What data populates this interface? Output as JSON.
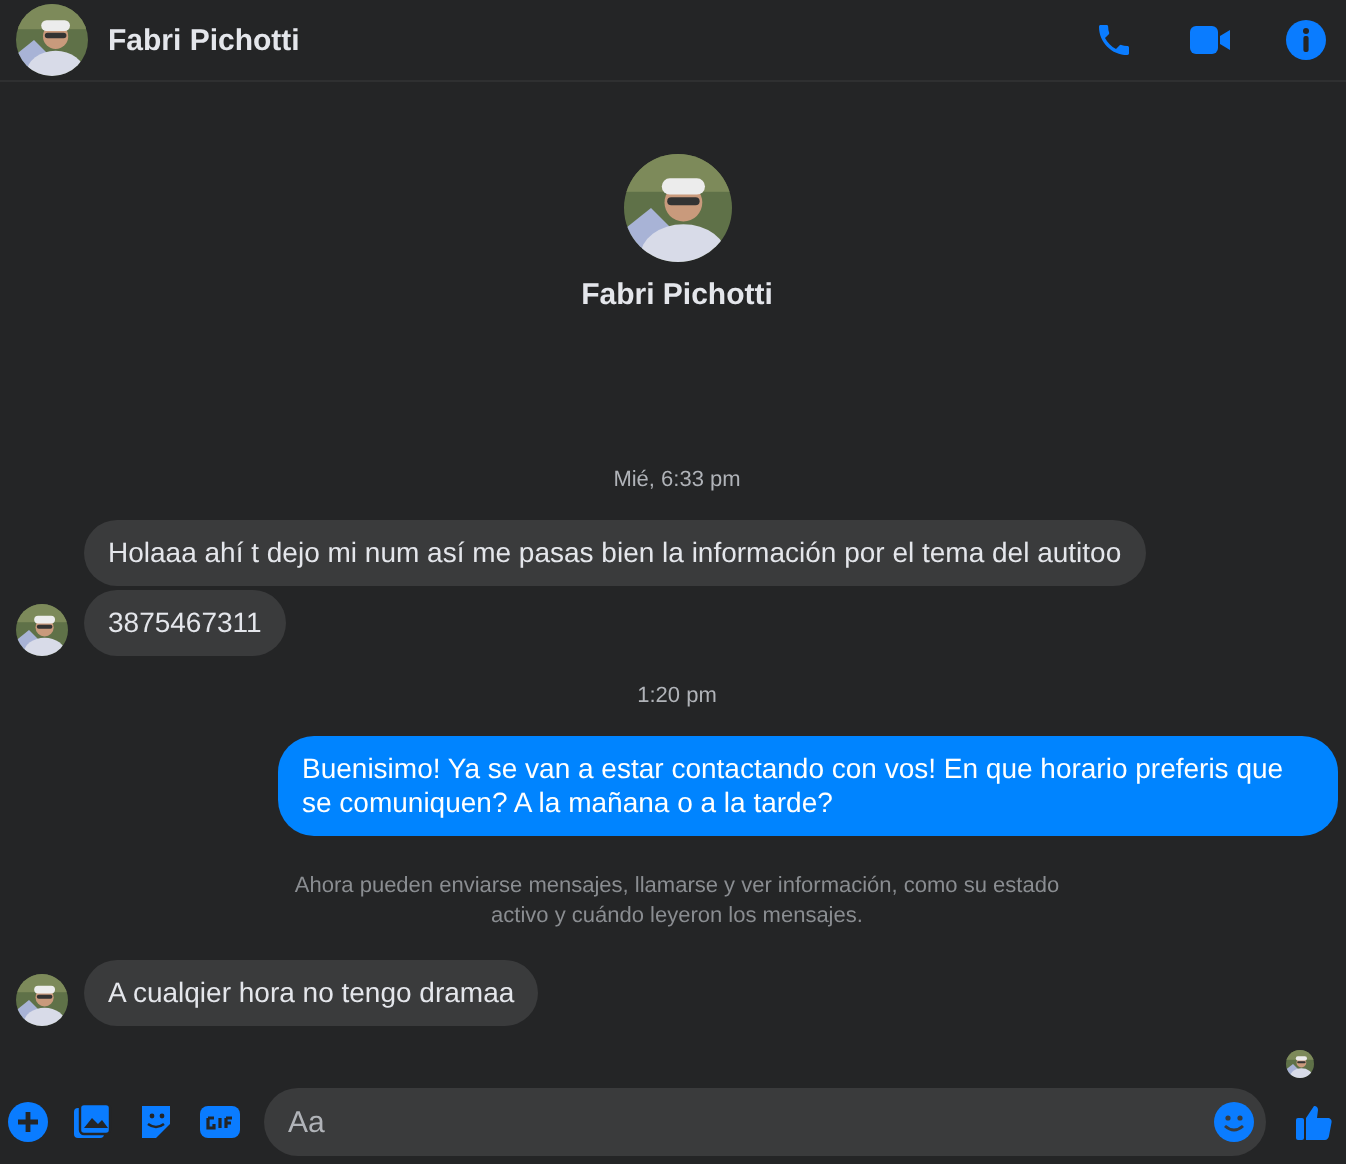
{
  "header": {
    "name": "Fabri Pichotti"
  },
  "profile": {
    "name": "Fabri Pichotti"
  },
  "messages": [
    {
      "kind": "time",
      "text": "Mié, 6:33 pm"
    },
    {
      "kind": "incoming",
      "text": "Holaaa ahí t dejo mi num así me pasas bien la información por el tema del autitoo",
      "avatar": false
    },
    {
      "kind": "incoming",
      "text": "3875467311",
      "avatar": true
    },
    {
      "kind": "time",
      "text": "1:20 pm"
    },
    {
      "kind": "outgoing",
      "text": "Buenisimo! Ya se van a estar contactando con vos! En que horario preferis que se comuniquen? A la mañana o a la tarde?"
    },
    {
      "kind": "notice",
      "text": "Ahora pueden enviarse mensajes, llamarse y ver información, como su estado activo y cuándo leyeron los mensajes."
    },
    {
      "kind": "incoming",
      "text": "A cualqier hora no tengo dramaa",
      "avatar": true
    }
  ],
  "read_receipt": true,
  "composer": {
    "placeholder": "Aa"
  }
}
